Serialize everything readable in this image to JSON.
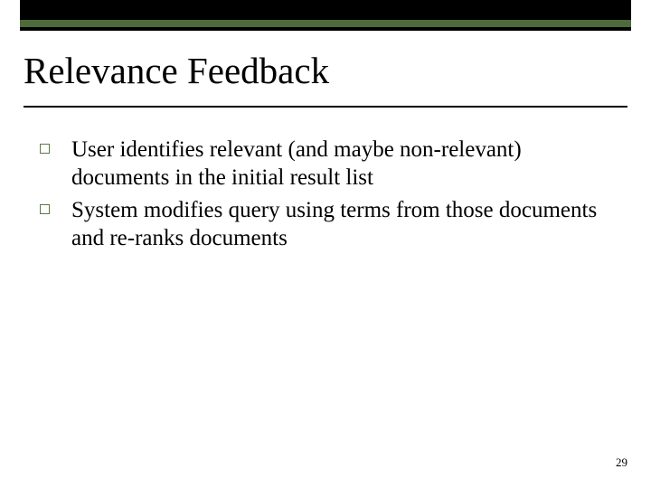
{
  "title": "Relevance Feedback",
  "bullets": [
    "User identifies relevant (and maybe non-relevant) documents in the initial result list",
    "System modifies query using terms from those documents and re-ranks documents"
  ],
  "page_number": "29"
}
